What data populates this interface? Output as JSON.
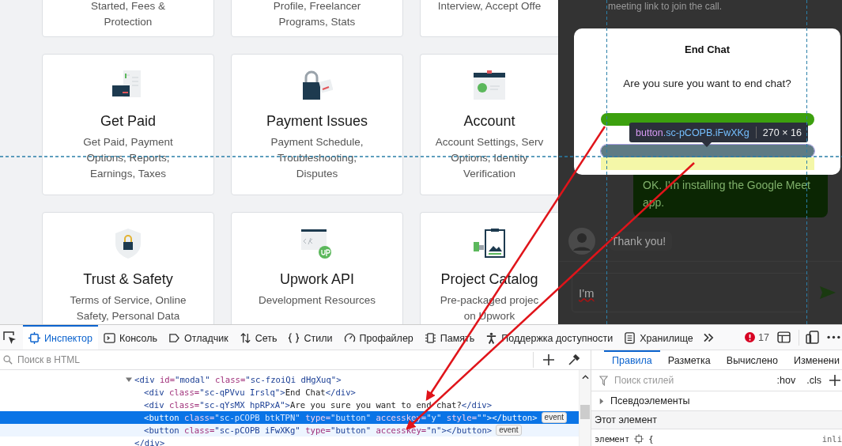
{
  "help_cards": [
    {
      "description": [
        "Started, Fees &",
        "Protection"
      ]
    },
    {
      "description": [
        "Profile, Freelancer",
        "Programs, Stats"
      ]
    },
    {
      "description": [
        "Interview, Accept Offe"
      ]
    },
    {
      "title": "Get Paid",
      "description": [
        "Get Paid, Payment",
        "Options, Reports,",
        "Earnings, Taxes"
      ]
    },
    {
      "title": "Payment Issues",
      "description": [
        "Payment Schedule,",
        "Troubleshooting,",
        "Disputes"
      ]
    },
    {
      "title": "Account",
      "description": [
        "Account Settings, Serv",
        "Options, Identity",
        "Verification"
      ]
    },
    {
      "title": "Trust & Safety",
      "description": [
        "Terms of Service, Online",
        "Safety, Personal Data"
      ]
    },
    {
      "title": "Upwork API",
      "description": [
        "Development Resources"
      ]
    },
    {
      "title": "Project Catalog",
      "description": [
        "Pre-packaged projec",
        "on Upwork"
      ]
    }
  ],
  "chat": {
    "messages": [
      {
        "kind": "plain",
        "text": "meeting link to join the call."
      },
      {
        "kind": "outgoing",
        "text": "OK. I'm installing the Google Meet app."
      },
      {
        "kind": "incoming",
        "text": "Thank you!"
      }
    ],
    "input": {
      "value": "I'm"
    }
  },
  "modal": {
    "title": "End Chat",
    "message": "Are you sure you want to end chat?",
    "buttons": [
      {
        "kind": "confirm",
        "highlighted": false
      },
      {
        "kind": "cancel",
        "highlighted": true
      }
    ]
  },
  "inspector_tooltip": {
    "element": "button",
    "classes": ".sc-pCOPB.iFwXKg",
    "size": "270 × 16"
  },
  "devtools": {
    "tools": [
      {
        "label": "Инспектор",
        "selected": true
      },
      {
        "label": "Консоль",
        "selected": false
      },
      {
        "label": "Отладчик",
        "selected": false
      },
      {
        "label": "Сеть",
        "selected": false
      },
      {
        "label": "Стили",
        "selected": false
      },
      {
        "label": "Профайлер",
        "selected": false
      },
      {
        "label": "Память",
        "selected": false
      },
      {
        "label": "Поддержка доступности",
        "selected": false
      },
      {
        "label": "Хранилище",
        "selected": false
      }
    ],
    "error_count": "17",
    "html_search": {
      "placeholder": "Поиск в HTML"
    },
    "tree": [
      {
        "expanded": true,
        "selected": false,
        "highlighted": false,
        "tokens": [
          {
            "kind": "tag",
            "text": "<div"
          },
          {
            "kind": "attr",
            "text": " id="
          },
          {
            "kind": "value",
            "text": "\"modal\""
          },
          {
            "kind": "attr",
            "text": " class="
          },
          {
            "kind": "value",
            "text": "\"sc-fzoiQi dHgXuq\""
          },
          {
            "kind": "tag",
            "text": ">"
          }
        ],
        "children": [
          {
            "selected": false,
            "highlighted": false,
            "tokens": [
              {
                "kind": "tag",
                "text": "<div"
              },
              {
                "kind": "attr",
                "text": " class="
              },
              {
                "kind": "value",
                "text": "\"sc-qPVvu Irslq\""
              },
              {
                "kind": "tag",
                "text": ">"
              },
              {
                "kind": "text",
                "text": "End Chat"
              },
              {
                "kind": "tag",
                "text": "</div>"
              }
            ]
          },
          {
            "selected": false,
            "highlighted": false,
            "tokens": [
              {
                "kind": "tag",
                "text": "<div"
              },
              {
                "kind": "attr",
                "text": " class="
              },
              {
                "kind": "value",
                "text": "\"sc-qYsMX hpRPxA\""
              },
              {
                "kind": "tag",
                "text": ">"
              },
              {
                "kind": "text",
                "text": "Are you sure you want to end chat?"
              },
              {
                "kind": "tag",
                "text": "</div>"
              }
            ]
          },
          {
            "selected": true,
            "highlighted": false,
            "badge": "event",
            "tokens": [
              {
                "kind": "tag",
                "text": "<button"
              },
              {
                "kind": "attr",
                "text": " class="
              },
              {
                "kind": "value",
                "text": "\"sc-pCOPB btkTPN\""
              },
              {
                "kind": "attr",
                "text": " type="
              },
              {
                "kind": "value",
                "text": "\"button\""
              },
              {
                "kind": "attr",
                "text": " accesskey="
              },
              {
                "kind": "value",
                "text": "\"y\""
              },
              {
                "kind": "attr",
                "text": " style="
              },
              {
                "kind": "value",
                "text": "\"\""
              },
              {
                "kind": "tag",
                "text": "></button>"
              }
            ]
          },
          {
            "selected": false,
            "highlighted": true,
            "badge": "event",
            "tokens": [
              {
                "kind": "tag",
                "text": "<button"
              },
              {
                "kind": "attr",
                "text": " class="
              },
              {
                "kind": "value",
                "text": "\"sc-pCOPB iFwXKg\""
              },
              {
                "kind": "attr",
                "text": " type="
              },
              {
                "kind": "value",
                "text": "\"button\""
              },
              {
                "kind": "attr",
                "text": " accesskey="
              },
              {
                "kind": "value",
                "text": "\"n\""
              },
              {
                "kind": "tag",
                "text": "></button>"
              }
            ]
          }
        ],
        "closing": [
          {
            "kind": "tag",
            "text": "</div>"
          }
        ]
      }
    ],
    "sidebar_tabs": [
      {
        "label": "Правила",
        "selected": true
      },
      {
        "label": "Разметка",
        "selected": false
      },
      {
        "label": "Вычислено",
        "selected": false
      },
      {
        "label": "Изменени",
        "selected": false
      }
    ],
    "style_filter": {
      "placeholder": "Поиск стилей"
    },
    "filter_buttons": [
      ":hov",
      ".cls"
    ],
    "pseudo_section": "Псевдоэлементы",
    "element_section": "Этот элемент",
    "rule": {
      "selector": "элемент",
      "brace": "{",
      "source": "inli"
    }
  }
}
